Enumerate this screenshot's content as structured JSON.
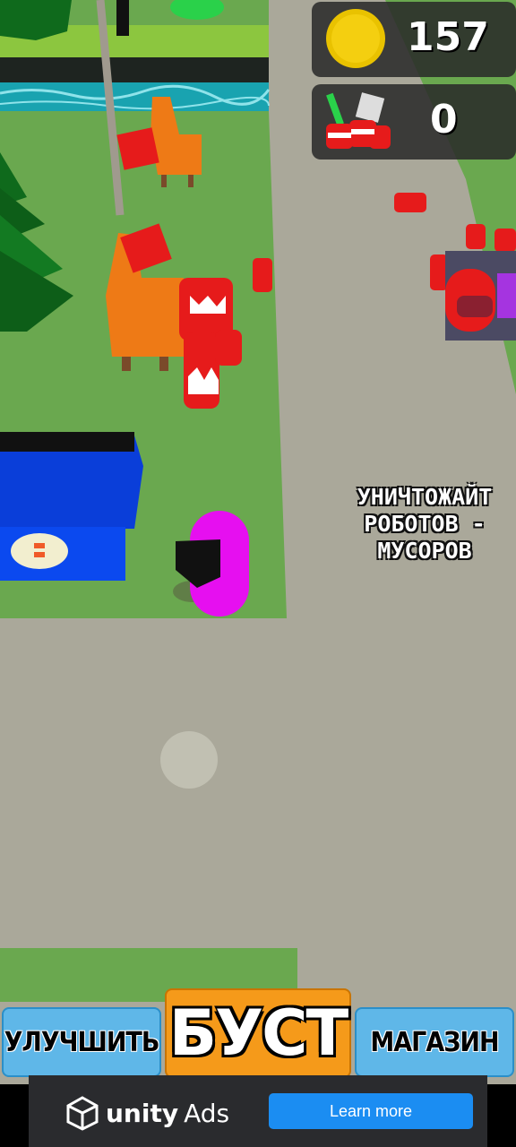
{
  "hud": {
    "coins": "157",
    "trash_collected": "0"
  },
  "hint": {
    "lines": [
      "УНИЧТОЖАЙТ",
      "РОБОТОВ -",
      "МУСОРОВ"
    ]
  },
  "buttons": {
    "upgrade": "УЛУЧШИТЬ",
    "boost": "БУСТ",
    "shop": "МАГАЗИН"
  },
  "ad": {
    "brand_word1": "unity",
    "brand_word2": "Ads",
    "cta": "Learn more"
  },
  "colors": {
    "grass": "#6aa84f",
    "road": "#aaa89a",
    "water": "#19a3b0",
    "player": "#e60ff0",
    "robot": "#e61b1b",
    "chair": "#ee7a16",
    "bin": "#0a3ed9",
    "button_blue": "#5fb7e8",
    "button_orange": "#f59a1a"
  }
}
